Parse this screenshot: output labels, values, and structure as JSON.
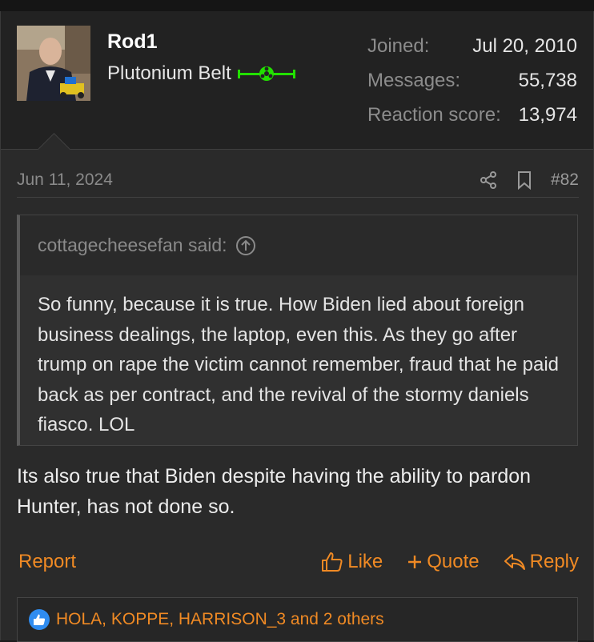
{
  "user": {
    "name": "Rod1",
    "title": "Plutonium Belt",
    "stats": [
      {
        "label": "Joined:",
        "value": "Jul 20, 2010"
      },
      {
        "label": "Messages:",
        "value": "55,738"
      },
      {
        "label": "Reaction score:",
        "value": "13,974"
      }
    ]
  },
  "post": {
    "date": "Jun 11, 2024",
    "number": "#82"
  },
  "quote": {
    "author": "cottagecheesefan said:",
    "text": "So funny, because it is true. How Biden lied about foreign business dealings, the laptop, even this. As they go after trump on rape the victim cannot remember, fraud that he paid back as per contract, and the revival of the stormy daniels fiasco. LOL"
  },
  "message": "Its also true that Biden despite having the ability to pardon Hunter, has not done so.",
  "actions": {
    "report": "Report",
    "like": "Like",
    "quote": "Quote",
    "reply": "Reply"
  },
  "reactions": {
    "text": "HOLA, KOPPE, HARRISON_3 and 2 others"
  },
  "colors": {
    "accent": "#f08a24",
    "badge": "#22e000",
    "like_bubble": "#2f8cf0"
  }
}
